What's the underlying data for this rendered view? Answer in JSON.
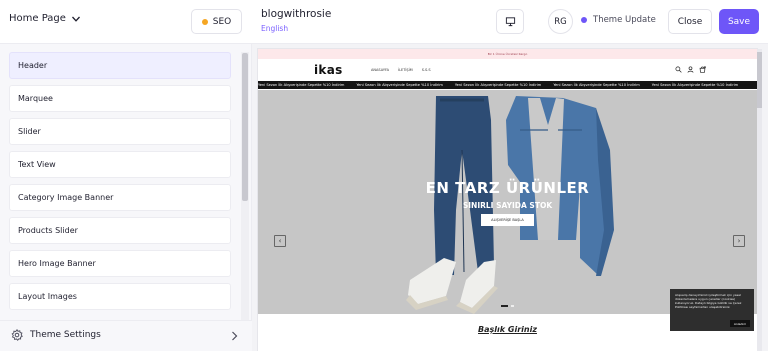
{
  "topbar": {
    "page_select_label": "Home Page",
    "seo_label": "SEO",
    "store_name": "blogwithrosie",
    "store_language": "English",
    "avatar_initials": "RG",
    "theme_status": "Theme Update",
    "close_label": "Close",
    "save_label": "Save",
    "colors": {
      "accent": "#6e56f8",
      "seo_dot": "#f5a623"
    }
  },
  "sidebar": {
    "sections": [
      {
        "label": "Header"
      },
      {
        "label": "Marquee"
      },
      {
        "label": "Slider"
      },
      {
        "label": "Text View"
      },
      {
        "label": "Category Image Banner"
      },
      {
        "label": "Products Slider"
      },
      {
        "label": "Hero Image Banner"
      },
      {
        "label": "Layout Images"
      }
    ],
    "theme_settings_label": "Theme Settings"
  },
  "preview": {
    "announcement": "Bir 1 Ürüne Ücretsiz Kargo",
    "logo": "ikas",
    "nav": [
      "ANASAYFA",
      "İLETİŞİM",
      "S.S.S"
    ],
    "ticker": [
      "Yeni Sezon İlk Alışverişinde Sepette %10 İndirim",
      "Yeni Sezon İlk Alışverişinde Sepette %10 İndirim",
      "Yeni Sezon İlk Alışverişinde Sepette %10 İndirim",
      "Yeni Sezon İlk Alışverişinde Sepette %10 İndirim",
      "Yeni Sezon İlk Alışverişinde Sepette %10 İndirim"
    ],
    "hero_title": "EN TARZ ÜRÜNLER",
    "hero_subtitle": "SINIRLI SAYIDA STOK",
    "hero_button": "ALIŞVERİŞE BAŞLA",
    "cookie_text": "Alışveriş deneyiminizi iyileştirmek için yasal düzenlemelere uygun çerezler (cookies) kullanıyoruz. Detaylı bilgiye Gizlilik ve Çerez Politikası sayfamızdan ulaşabilirsiniz.",
    "cookie_button": "Anladım",
    "section_heading": "Başlık Giriniz"
  }
}
